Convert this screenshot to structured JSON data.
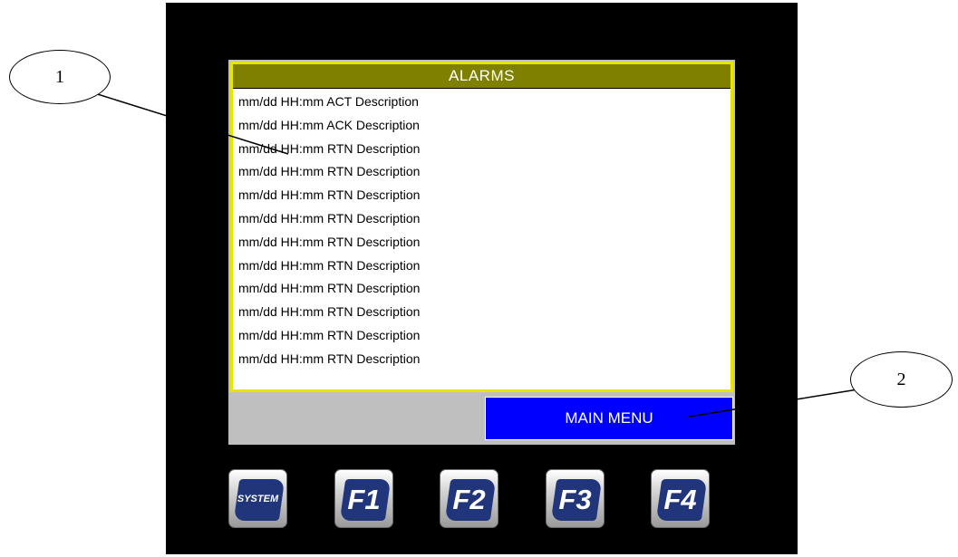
{
  "alarms": {
    "title": "ALARMS",
    "entries": [
      "mm/dd HH:mm ACT Description",
      "mm/dd HH:mm ACK Description",
      "mm/dd HH:mm RTN Description",
      "mm/dd HH:mm RTN Description",
      "mm/dd HH:mm RTN Description",
      "mm/dd HH:mm RTN Description",
      "mm/dd HH:mm RTN Description",
      "mm/dd HH:mm RTN Description",
      "mm/dd HH:mm RTN Description",
      "mm/dd HH:mm RTN Description",
      "mm/dd HH:mm RTN Description",
      "mm/dd HH:mm RTN Description"
    ]
  },
  "main_menu_label": "MAIN MENU",
  "function_keys": [
    "SYSTEM",
    "F1",
    "F2",
    "F3",
    "F4"
  ],
  "callouts": [
    "1",
    "2"
  ],
  "colors": {
    "bezel": "#000000",
    "alarm_header": "#808000",
    "alarm_border": "#e6e600",
    "main_menu": "#0000ff",
    "key_plate": "#21357a"
  }
}
